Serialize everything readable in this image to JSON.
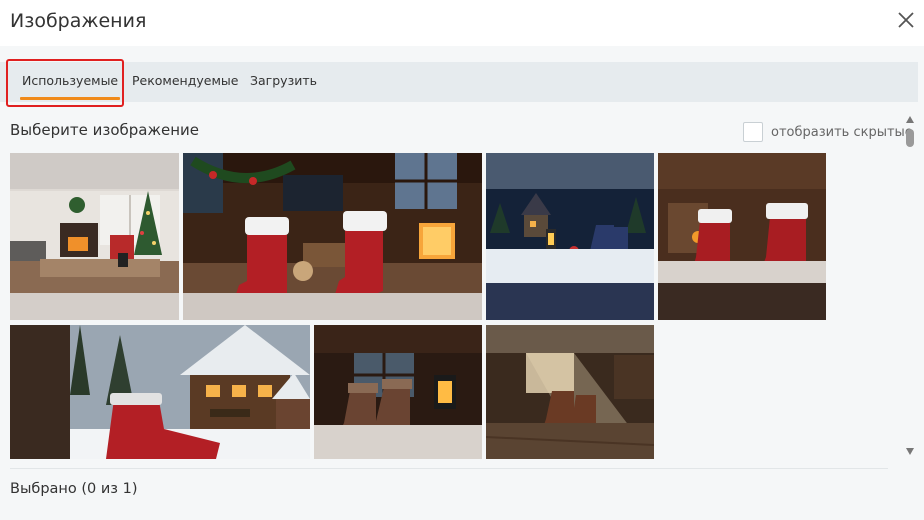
{
  "dialog": {
    "title": "Изображения"
  },
  "tabs": [
    {
      "label": "Используемые",
      "active": true
    },
    {
      "label": "Рекомендуемые",
      "active": false
    },
    {
      "label": "Загрузить",
      "active": false
    }
  ],
  "content": {
    "prompt": "Выберите изображение",
    "show_hidden_label": "отобразить скрытые",
    "show_hidden_checked": false
  },
  "images": [
    {
      "scene": "living-room-christmas-tree"
    },
    {
      "scene": "red-valenki-cabin-window"
    },
    {
      "scene": "snowy-village-night-boots"
    },
    {
      "scene": "red-boots-cabin-interior"
    },
    {
      "scene": "red-boot-snowy-house"
    },
    {
      "scene": "felt-boots-candle-window"
    },
    {
      "scene": "brown-boots-sunlit-cabin"
    }
  ],
  "footer": {
    "selected_status": "Выбрано (0 из 1)"
  },
  "colors": {
    "accent": "#f08a1a",
    "highlight": "#e02020",
    "tab_bar": "#e6ebee",
    "panel": "#f5f7f8"
  }
}
